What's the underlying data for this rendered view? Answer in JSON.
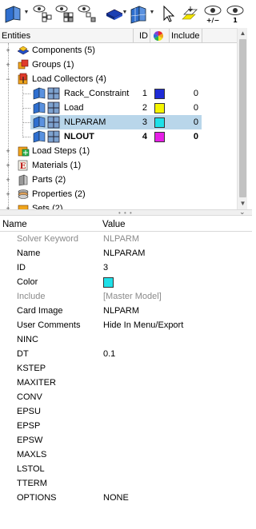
{
  "toolbar": {
    "buttons": [
      {
        "name": "entity-display-icon",
        "dropdown": true
      },
      {
        "name": "show-entity-icon",
        "dropdown": false
      },
      {
        "name": "show-hide-icon",
        "dropdown": false
      },
      {
        "name": "isolate-icon",
        "dropdown": false
      },
      {
        "name": "shaded-mode-icon",
        "dropdown": true
      },
      {
        "name": "element-display-icon",
        "dropdown": true
      },
      {
        "name": "select-cursor-icon",
        "dropdown": false
      },
      {
        "name": "highlight-icon",
        "dropdown": false
      },
      {
        "name": "show-plus-minus-icon",
        "dropdown": false,
        "caption": "+/−"
      },
      {
        "name": "show-one-icon",
        "dropdown": false,
        "caption": "1"
      }
    ]
  },
  "tree": {
    "headers": {
      "entities": "Entities",
      "id": "ID",
      "include": "Include"
    },
    "rows": [
      {
        "label": "Components (5)",
        "level": 0,
        "expander": "+",
        "icon": "components-icon",
        "id": "",
        "include": "",
        "color": ""
      },
      {
        "label": "Groups (1)",
        "level": 0,
        "expander": "+",
        "icon": "groups-icon",
        "id": "",
        "include": "",
        "color": ""
      },
      {
        "label": "Load Collectors (4)",
        "level": 0,
        "expander": "−",
        "icon": "load-collectors-icon",
        "id": "",
        "include": "",
        "color": ""
      },
      {
        "label": "Rack_Constraint",
        "level": 1,
        "expander": "",
        "icon": "load-collector-icon",
        "id": "1",
        "include": "0",
        "color": "#1f2bd6"
      },
      {
        "label": "Load",
        "level": 1,
        "expander": "",
        "icon": "load-collector-icon",
        "id": "2",
        "include": "0",
        "color": "#f5f500"
      },
      {
        "label": "NLPARAM",
        "level": 1,
        "expander": "",
        "icon": "load-collector-icon",
        "id": "3",
        "include": "0",
        "color": "#1fe0e8",
        "selected": true
      },
      {
        "label": "NLOUT",
        "level": 1,
        "expander": "",
        "icon": "load-collector-icon",
        "id": "4",
        "include": "0",
        "color": "#e61fe6",
        "bold": true
      },
      {
        "label": "Load Steps (1)",
        "level": 0,
        "expander": "+",
        "icon": "load-steps-icon",
        "id": "",
        "include": "",
        "color": ""
      },
      {
        "label": "Materials (1)",
        "level": 0,
        "expander": "+",
        "icon": "materials-icon",
        "id": "",
        "include": "",
        "color": ""
      },
      {
        "label": "Parts (2)",
        "level": 0,
        "expander": "+",
        "icon": "parts-icon",
        "id": "",
        "include": "",
        "color": ""
      },
      {
        "label": "Properties (2)",
        "level": 0,
        "expander": "+",
        "icon": "properties-icon",
        "id": "",
        "include": "",
        "color": ""
      },
      {
        "label": "Sets (2)",
        "level": 0,
        "expander": "+",
        "icon": "sets-icon",
        "id": "",
        "include": "",
        "color": ""
      }
    ]
  },
  "properties": {
    "headers": {
      "name": "Name",
      "value": "Value"
    },
    "rows": [
      {
        "name": "Solver Keyword",
        "value": "NLPARM",
        "dim": true
      },
      {
        "name": "Name",
        "value": "NLPARAM"
      },
      {
        "name": "ID",
        "value": "3"
      },
      {
        "name": "Color",
        "value": "",
        "color": "#1fe0e8"
      },
      {
        "name": "Include",
        "value": "[Master Model]",
        "dim": true
      },
      {
        "name": "Card Image",
        "value": "NLPARM"
      },
      {
        "name": "User Comments",
        "value": "Hide In Menu/Export"
      },
      {
        "name": "NINC",
        "value": ""
      },
      {
        "name": "DT",
        "value": "0.1"
      },
      {
        "name": "KSTEP",
        "value": ""
      },
      {
        "name": "MAXITER",
        "value": ""
      },
      {
        "name": "CONV",
        "value": ""
      },
      {
        "name": "EPSU",
        "value": ""
      },
      {
        "name": "EPSP",
        "value": ""
      },
      {
        "name": "EPSW",
        "value": ""
      },
      {
        "name": "MAXLS",
        "value": ""
      },
      {
        "name": "LSTOL",
        "value": ""
      },
      {
        "name": "TTERM",
        "value": ""
      },
      {
        "name": "OPTIONS",
        "value": "NONE"
      }
    ]
  }
}
